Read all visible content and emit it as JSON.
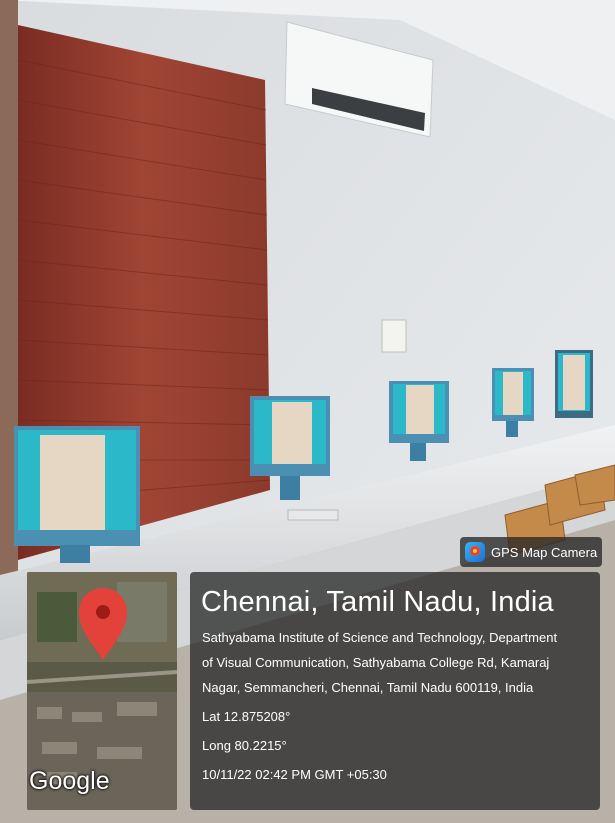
{
  "badge": {
    "label": "GPS Map Camera",
    "icon": "gps-map-camera-icon"
  },
  "location": {
    "city": "Chennai, Tamil Nadu, India",
    "address_lines": [
      "Sathyabama Institute of Science and Technology, Department",
      "of Visual Communication, Sathyabama College Rd, Kamaraj",
      "Nagar, Semmancheri, Chennai, Tamil Nadu 600119, India"
    ],
    "lat": "Lat 12.875208°",
    "long": "Long 80.2215°",
    "timestamp": "10/11/22 02:42 PM GMT +05:30"
  },
  "map": {
    "brand": "Google",
    "pin_color": "#e3423b"
  },
  "colors": {
    "curtain": "#8e3a2e",
    "monitor_screen": "#2bb8c9",
    "overlay_bg": "#1e1e1e"
  }
}
